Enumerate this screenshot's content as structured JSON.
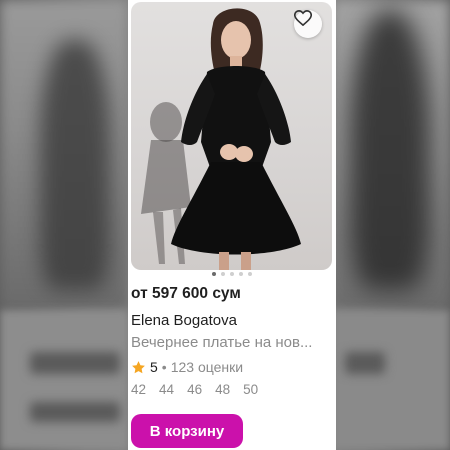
{
  "product": {
    "price": "от 597 600 сум",
    "brand": "Elena Bogatova",
    "title": "Вечернее платье на нов...",
    "rating": "5",
    "separator": "•",
    "reviews": "123 оценки",
    "sizes": [
      "42",
      "44",
      "46",
      "48",
      "50"
    ],
    "cart_label": "В корзину",
    "image_dots": 5,
    "active_dot": 0
  },
  "colors": {
    "accent": "#cb11ab",
    "star": "#f5a623",
    "muted_text": "#8b8b8b",
    "text": "#1f1f1f"
  },
  "icons": {
    "favorite": "heart-outline-icon",
    "rating": "star-icon"
  }
}
